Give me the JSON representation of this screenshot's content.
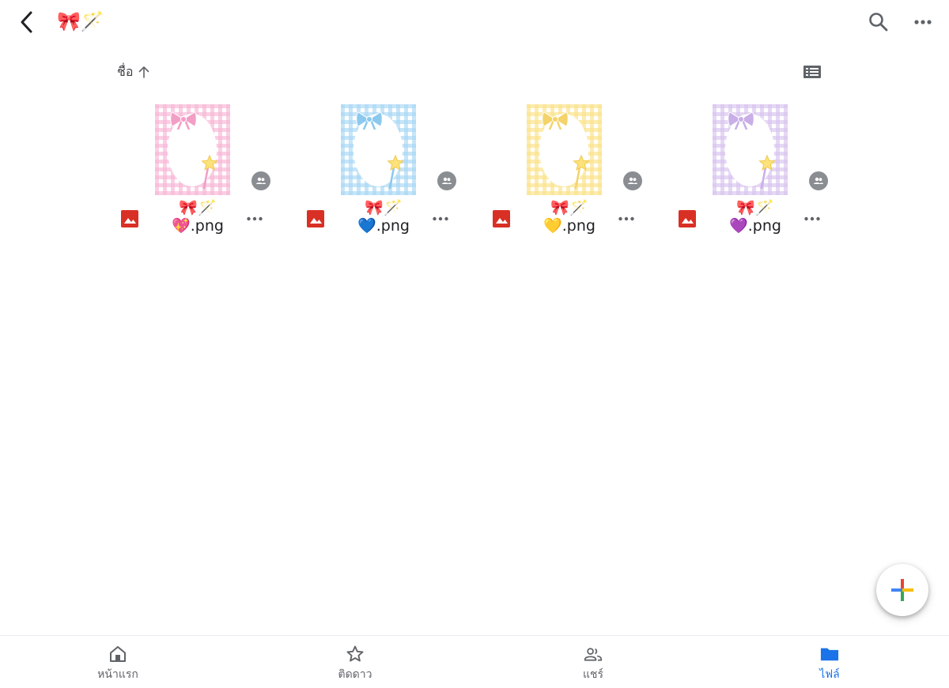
{
  "header": {
    "folder_title": "🎀🪄",
    "back_icon": "chevron-left-icon",
    "search_icon": "search-icon",
    "more_icon": "more-horizontal-icon"
  },
  "sort": {
    "label": "ชื่อ",
    "direction_icon": "arrow-up-icon",
    "view_toggle_icon": "list-view-icon"
  },
  "files": [
    {
      "name": "🎀🪄💖.png",
      "type_icon": "image-file-icon",
      "shared": true,
      "theme": "pink",
      "grid_color": "#f7b7d6",
      "accent": "#f29fc6"
    },
    {
      "name": "🎀🪄💙.png",
      "type_icon": "image-file-icon",
      "shared": true,
      "theme": "blue",
      "grid_color": "#a9d8f5",
      "accent": "#8cc9ee"
    },
    {
      "name": "🎀🪄💛.png",
      "type_icon": "image-file-icon",
      "shared": true,
      "theme": "yellow",
      "grid_color": "#fbe38a",
      "accent": "#f4d36a"
    },
    {
      "name": "🎀🪄💜.png",
      "type_icon": "image-file-icon",
      "shared": true,
      "theme": "purple",
      "grid_color": "#d8c4ef",
      "accent": "#c9aee8"
    }
  ],
  "fab": {
    "icon": "plus-icon"
  },
  "bottom_nav": [
    {
      "label": "หน้าแรก",
      "icon": "home-icon",
      "active": false
    },
    {
      "label": "ติดดาว",
      "icon": "star-icon",
      "active": false
    },
    {
      "label": "แชร์",
      "icon": "people-icon",
      "active": false
    },
    {
      "label": "ไฟล์",
      "icon": "folder-icon",
      "active": true
    }
  ],
  "colors": {
    "accent_blue": "#1a73e8",
    "file_type_red": "#d93025",
    "icon_gray": "#5f6368"
  }
}
